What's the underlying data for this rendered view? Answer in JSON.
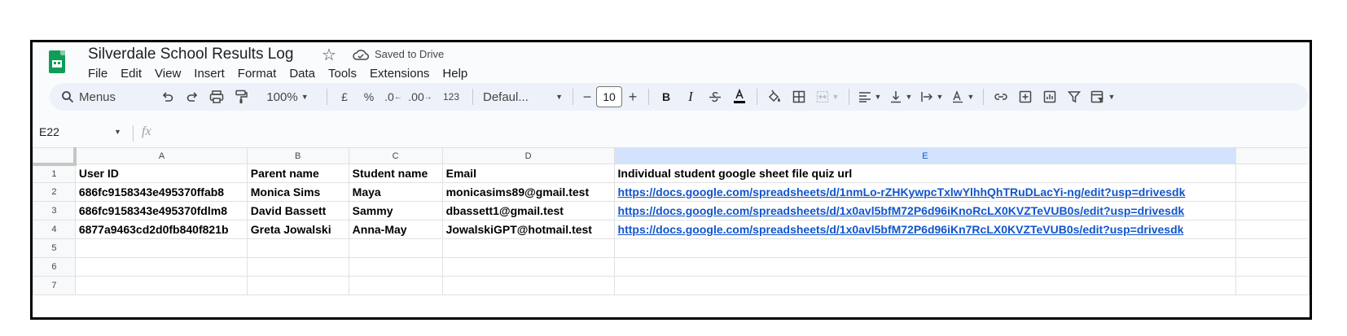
{
  "app": {
    "doc_title": "Silverdale School Results Log",
    "save_status": "Saved to Drive"
  },
  "menu": [
    "File",
    "Edit",
    "View",
    "Insert",
    "Format",
    "Data",
    "Tools",
    "Extensions",
    "Help"
  ],
  "toolbar": {
    "search_label": "Menus",
    "zoom": "100%",
    "currency": "£",
    "percent": "%",
    "decrease_decimal": ".0",
    "increase_decimal": ".00",
    "number_format": "123",
    "font": "Defaul...",
    "font_size": "10",
    "minus": "−",
    "plus": "+",
    "bold": "B",
    "italic": "I"
  },
  "formula_bar": {
    "cell_ref": "E22",
    "fx": "fx",
    "value": ""
  },
  "columns": [
    "A",
    "B",
    "C",
    "D",
    "E"
  ],
  "selected_column": "E",
  "rows": [
    {
      "num": "1",
      "cells": [
        "User ID",
        "Parent name",
        "Student name",
        "Email",
        "Individual student google sheet file quiz url"
      ]
    },
    {
      "num": "2",
      "cells": [
        "686fc9158343e495370ffab8",
        "Monica Sims",
        "Maya",
        "monicasims89@gmail.test",
        "https://docs.google.com/spreadsheets/d/1nmLo-rZHKywpcTxlwYlhhQhTRuDLacYi-ng/edit?usp=drivesdk"
      ]
    },
    {
      "num": "3",
      "cells": [
        "686fc9158343e495370fdlm8",
        "David Bassett",
        "Sammy",
        "dbassett1@gmail.test",
        "https://docs.google.com/spreadsheets/d/1x0avl5bfM72P6d96iKnoRcLX0KVZTeVUB0s/edit?usp=drivesdk"
      ]
    },
    {
      "num": "4",
      "cells": [
        "6877a9463cd2d0fb840f821b",
        "Greta Jowalski",
        "Anna-May",
        "JowalskiGPT@hotmail.test",
        "https://docs.google.com/spreadsheets/d/1x0avl5bfM72P6d96iKn7RcLX0KVZTeVUB0s/edit?usp=drivesdk"
      ]
    },
    {
      "num": "5",
      "cells": [
        "",
        "",
        "",
        "",
        ""
      ]
    },
    {
      "num": "6",
      "cells": [
        "",
        "",
        "",
        "",
        ""
      ]
    },
    {
      "num": "7",
      "cells": [
        "",
        "",
        "",
        "",
        ""
      ]
    }
  ],
  "colors": {
    "logo_green": "#0f9d58",
    "link_blue": "#1155cc",
    "selected_header": "#d3e3fd",
    "toolbar_bg": "#edf2fa"
  }
}
